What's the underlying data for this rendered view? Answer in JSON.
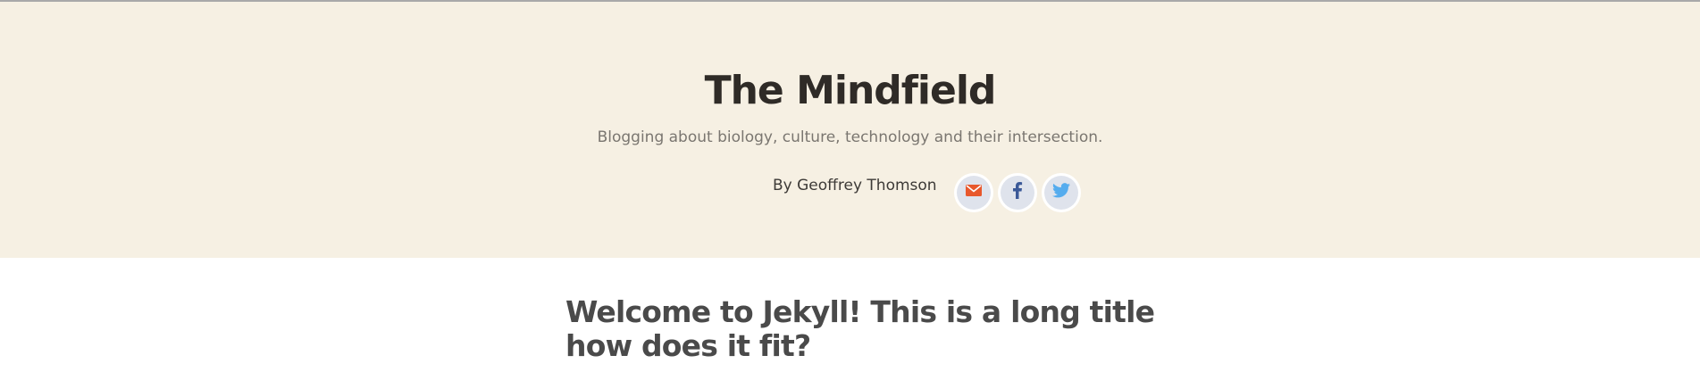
{
  "header": {
    "site_title": "The Mindfield",
    "tagline": "Blogging about biology, culture, technology and their intersection.",
    "byline": "By Geoffrey Thomson",
    "social": [
      {
        "name": "email",
        "icon": "envelope-icon",
        "color": "#e8582c"
      },
      {
        "name": "facebook",
        "icon": "facebook-icon",
        "color": "#3b5998"
      },
      {
        "name": "twitter",
        "icon": "twitter-bird-icon",
        "color": "#55acee"
      }
    ]
  },
  "post": {
    "title": "Welcome to Jekyll! This is a long title how does it fit?"
  },
  "colors": {
    "masthead_bg": "#f6f0e3",
    "title": "#2f2b27",
    "tagline": "#7a7670",
    "post_title": "#4a4a4a"
  }
}
